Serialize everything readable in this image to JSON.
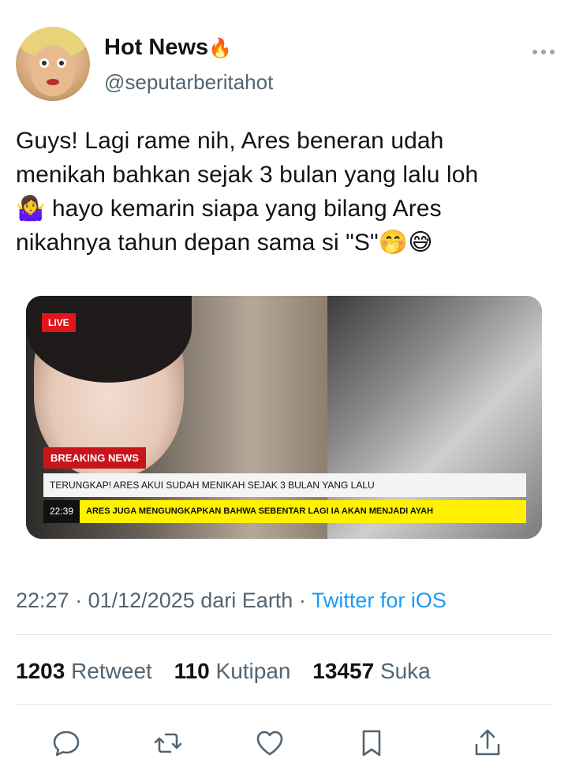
{
  "user": {
    "display_name": "Hot News",
    "name_emoji": "🔥",
    "handle": "@seputarberitahot"
  },
  "tweet": {
    "text": "Guys! Lagi rame nih, Ares beneran udah\nmenikah bahkan sejak 3 bulan yang lalu loh\n🤷‍♀️ hayo kemarin siapa yang bilang Ares\nnikahnya tahun depan sama si \"S\"🤭😅"
  },
  "media": {
    "live_label": "LIVE",
    "breaking_label": "BREAKING NEWS",
    "headline": "TERUNGKAP! ARES AKUI SUDAH MENIKAH SEJAK 3 BULAN YANG LALU",
    "ticker_time": "22:39",
    "ticker_text": "ARES JUGA MENGUNGKAPKAN BAHWA SEBENTAR LAGI IA AKAN MENJADI AYAH"
  },
  "meta": {
    "time": "22:27",
    "sep1": "·",
    "date": "01/12/2025",
    "location": "dari Earth",
    "sep2": "·",
    "source": "Twitter for iOS"
  },
  "stats": {
    "retweets": "1203",
    "retweets_label": "Retweet",
    "quotes": "110",
    "quotes_label": "Kutipan",
    "likes": "13457",
    "likes_label": "Suka"
  },
  "icons": {
    "more": "more-icon",
    "reply": "reply-icon",
    "retweet": "retweet-icon",
    "like": "like-icon",
    "bookmark": "bookmark-icon",
    "share": "share-icon"
  },
  "colors": {
    "link": "#1d9bf0",
    "secondary": "#536471",
    "live": "#e3141b",
    "ticker": "#fff100"
  }
}
